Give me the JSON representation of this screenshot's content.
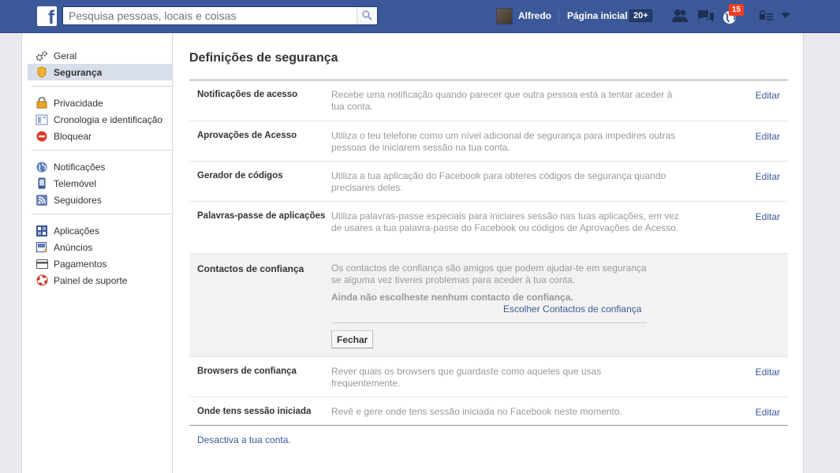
{
  "search": {
    "placeholder": "Pesquisa pessoas, locais e coisas"
  },
  "header": {
    "user_name": "Alfredo",
    "home_label": "Página inicial",
    "home_count": "20+",
    "notifications_badge": "15"
  },
  "sidebar": {
    "groups": [
      [
        {
          "label": "Geral",
          "icon": "gears-icon"
        },
        {
          "label": "Segurança",
          "icon": "security-badge-icon",
          "active": true
        }
      ],
      [
        {
          "label": "Privacidade",
          "icon": "lock-icon"
        },
        {
          "label": "Cronologia e identificação",
          "icon": "timeline-icon"
        },
        {
          "label": "Bloquear",
          "icon": "block-icon"
        }
      ],
      [
        {
          "label": "Notificações",
          "icon": "globe-icon"
        },
        {
          "label": "Telemóvel",
          "icon": "mobile-icon"
        },
        {
          "label": "Seguidores",
          "icon": "rss-icon"
        }
      ],
      [
        {
          "label": "Aplicações",
          "icon": "apps-icon"
        },
        {
          "label": "Anúncios",
          "icon": "ads-icon"
        },
        {
          "label": "Pagamentos",
          "icon": "card-icon"
        },
        {
          "label": "Painel de suporte",
          "icon": "lifebuoy-icon"
        }
      ]
    ]
  },
  "main": {
    "title": "Definições de segurança",
    "edit_label": "Editar",
    "rows": [
      {
        "label": "Notificações de acesso",
        "desc": "Recebe uma notificação quando parecer que outra pessoa está a tentar aceder à tua conta."
      },
      {
        "label": "Aprovações de Acesso",
        "desc": "Utiliza o teu telefone como um nível adicional de segurança para impedires outras pessoas de iniciarem sessão na tua conta."
      },
      {
        "label": "Gerador de códigos",
        "desc": "Utiliza a tua aplicação do Facebook para obteres códigos de segurança quando precisares deles."
      },
      {
        "label": "Palavras-passe de aplicações",
        "desc": "Utiliza palavras-passe especiais para iniciares sessão nas tuas aplicações, em vez de usares a tua palavra-passe do Facebook ou códigos de Aprovações de Acesso."
      }
    ],
    "trusted": {
      "label": "Contactos de confiança",
      "desc": "Os contactos de confiança são amigos que podem ajudar-te em segurança se alguma vez tiveres problemas para aceder à tua conta.",
      "note": "Ainda não escolheste nenhum contacto de confiança.",
      "choose_link": "Escolher Contactos de confiança",
      "close_button": "Fechar"
    },
    "rows_after": [
      {
        "label": "Browsers de confiança",
        "desc": "Rever quais os browsers que guardaste como aqueles que usas frequentemente."
      },
      {
        "label": "Onde tens sessão iniciada",
        "desc": "Revê e gere onde tens sessão iniciada no Facebook neste momento."
      }
    ],
    "deactivate": "Desactiva a tua conta."
  }
}
